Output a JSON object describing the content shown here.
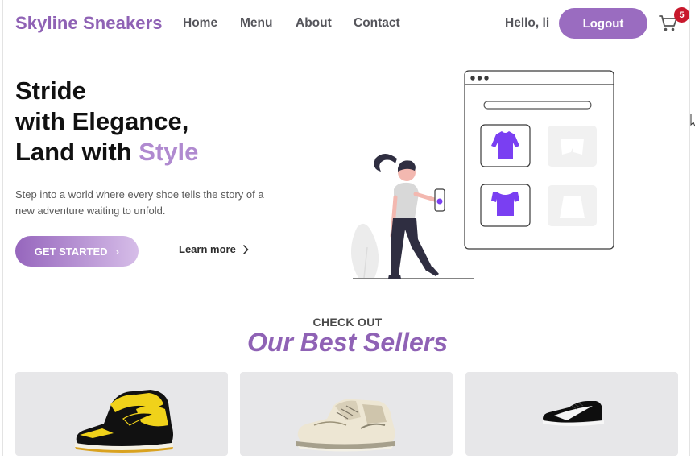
{
  "header": {
    "brand": "Skyline Sneakers",
    "nav": [
      "Home",
      "Menu",
      "About",
      "Contact"
    ],
    "greeting": "Hello, li",
    "logout_label": "Logout",
    "cart_icon": "cart-icon",
    "cart_count": "5"
  },
  "hero": {
    "title_line1": "Stride",
    "title_line2": "with Elegance,",
    "title_line3_prefix": "Land with ",
    "title_line3_accent": "Style",
    "description": "Step into a world where every shoe tells the story of a new adventure waiting to unfold.",
    "cta_label": "GET STARTED",
    "learn_more_label": "Learn more"
  },
  "best_sellers": {
    "eyebrow": "CHECK OUT",
    "title": "Our Best Sellers"
  },
  "colors": {
    "brand": "#8f62b5",
    "accent_light": "#b08ad0",
    "badge": "#c8182c"
  }
}
